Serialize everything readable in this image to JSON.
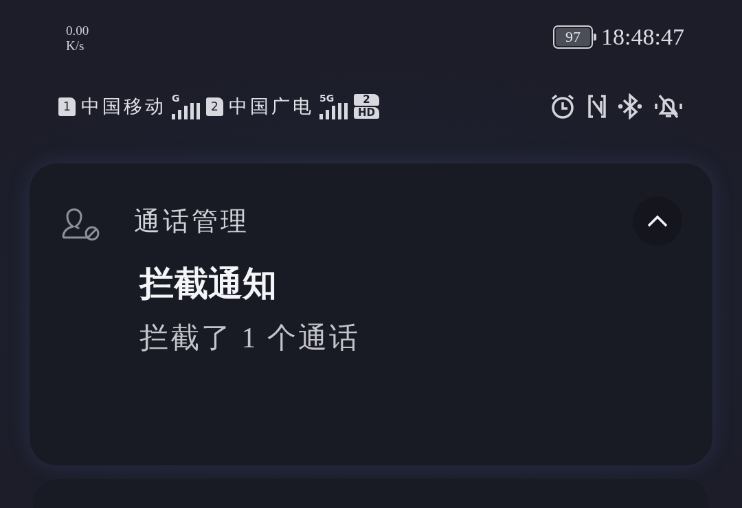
{
  "status_bar": {
    "net_speed": "0.00",
    "net_unit": "K/s",
    "battery": "97",
    "time": "18:48:47"
  },
  "sims": [
    {
      "slot": "1",
      "carrier": "中国移动",
      "network": "G"
    },
    {
      "slot": "2",
      "carrier": "中国广电",
      "network": "5G",
      "hd_slot": "2",
      "hd_label": "HD"
    }
  ],
  "notification": {
    "app": "通话管理",
    "title": "拦截通知",
    "body": "拦截了 1 个通话",
    "expanded": true
  }
}
